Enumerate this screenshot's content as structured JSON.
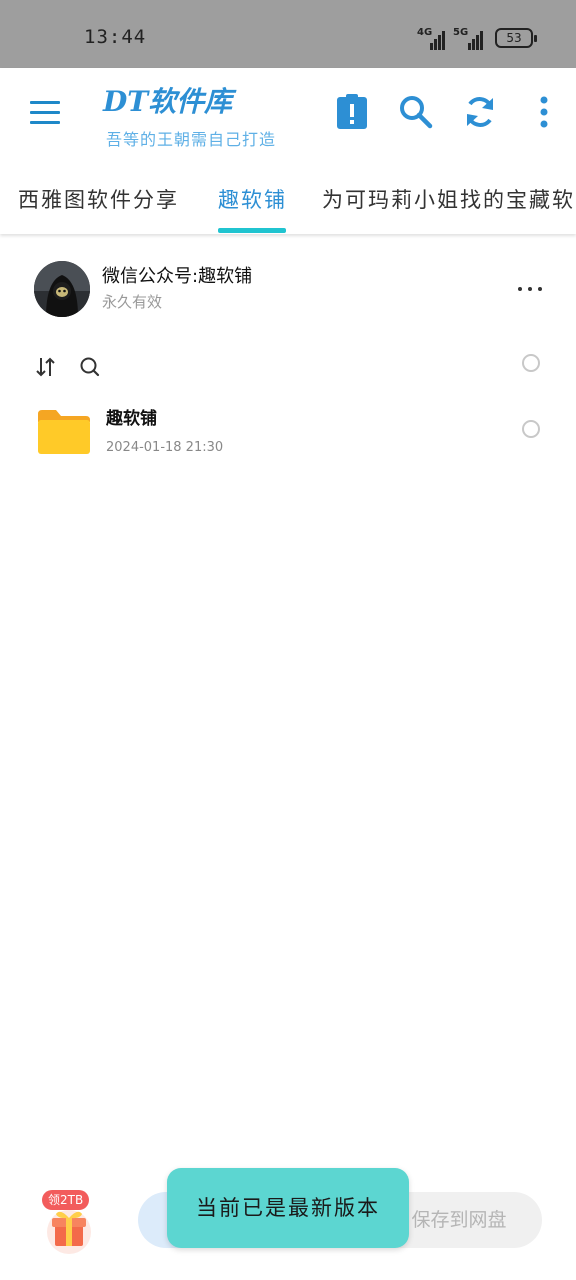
{
  "status_bar": {
    "time": "13:44",
    "signal_1_label": "4G",
    "signal_2_label": "5G",
    "battery": "53"
  },
  "app_bar": {
    "title": "DT软件库",
    "subtitle": "吾等的王朝需自己打造",
    "icons": [
      "menu-icon",
      "clipboard-alert-icon",
      "search-icon",
      "refresh-icon",
      "more-vertical-icon"
    ],
    "accent_color": "#2d8fd4"
  },
  "tabs": [
    {
      "label": "西雅图软件分享",
      "active": false
    },
    {
      "label": "趣软铺",
      "active": true
    },
    {
      "label": "为可玛莉小姐找的宝藏软",
      "active": false
    }
  ],
  "share": {
    "title": "微信公众号:趣软铺",
    "validity": "永久有效"
  },
  "toolbar": {
    "icons": [
      "sort-icon",
      "search-icon"
    ]
  },
  "files": [
    {
      "name": "趣软铺",
      "date": "2024-01-18 21:30",
      "icon": "folder-icon"
    }
  ],
  "bottom": {
    "gift_badge": "领2TB",
    "save_button": "保存到网盘"
  },
  "toast": {
    "message": "当前已是最新版本",
    "color": "#5cd6d1"
  }
}
